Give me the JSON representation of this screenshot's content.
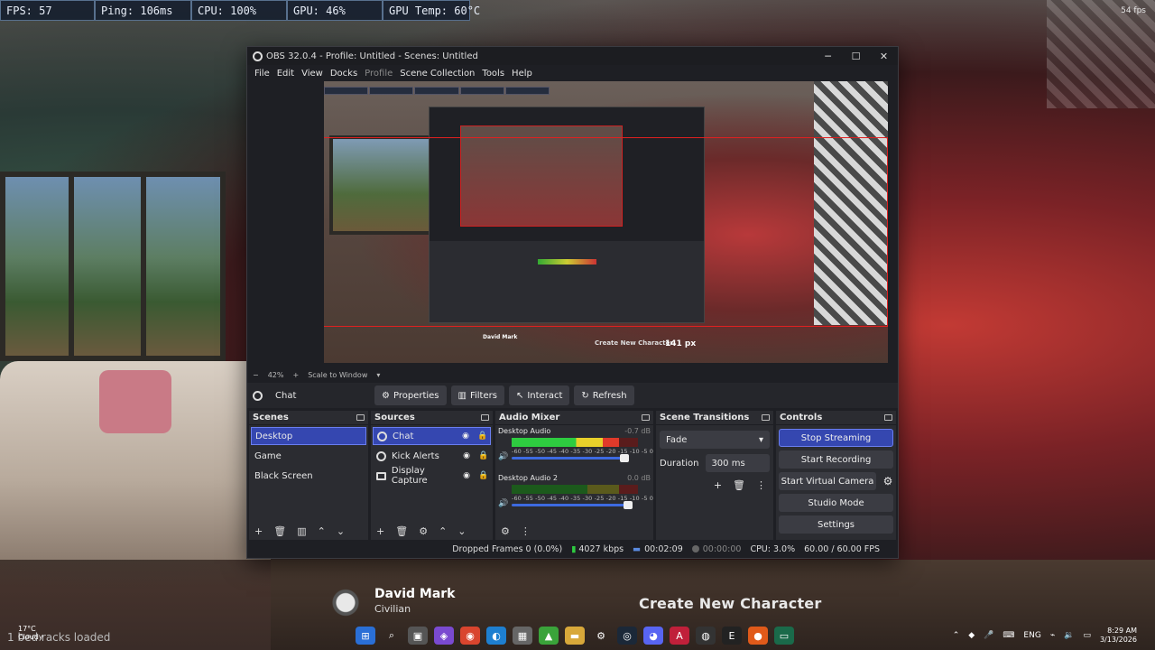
{
  "overlay": {
    "stats": [
      "FPS: 57",
      "Ping: 106ms",
      "CPU: 100%",
      "GPU: 46%",
      "GPU Temp: 60°C"
    ],
    "corner_fps": "54 fps"
  },
  "obs": {
    "title": "OBS 32.0.4 - Profile: Untitled - Scenes: Untitled",
    "menu": [
      "File",
      "Edit",
      "View",
      "Docks",
      "Profile",
      "Scene Collection",
      "Tools",
      "Help"
    ],
    "preview": {
      "measure_label": "141 px",
      "mini_name": "David Mark",
      "mini_cta": "Create New Character"
    },
    "zoom": {
      "minus": "−",
      "level": "42%",
      "plus": "+",
      "mode": "Scale to Window"
    },
    "context": {
      "source_name": "Chat",
      "buttons": {
        "properties": "Properties",
        "filters": "Filters",
        "interact": "Interact",
        "refresh": "Refresh"
      }
    },
    "scenes": {
      "title": "Scenes",
      "items": [
        "Desktop",
        "Game",
        "Black Screen"
      ]
    },
    "sources": {
      "title": "Sources",
      "items": [
        "Chat",
        "Kick Alerts",
        "Display Capture"
      ]
    },
    "mixer": {
      "title": "Audio Mixer",
      "ticks": "-60 -55 -50 -45 -40 -35 -30 -25 -20 -15 -10 -5 0",
      "channels": [
        {
          "name": "Desktop Audio",
          "db": "-0.7 dB",
          "level": 0.85,
          "fader": 0.9
        },
        {
          "name": "Desktop Audio 2",
          "db": "0.0 dB",
          "level": 0.0,
          "fader": 0.93
        }
      ]
    },
    "transitions": {
      "title": "Scene Transitions",
      "selected": "Fade",
      "duration_label": "Duration",
      "duration_value": "300 ms"
    },
    "controls": {
      "title": "Controls",
      "stop_streaming": "Stop Streaming",
      "start_recording": "Start Recording",
      "start_virtual_camera": "Start Virtual Camera",
      "studio_mode": "Studio Mode",
      "settings": "Settings"
    },
    "status": {
      "dropped_frames": "Dropped Frames 0 (0.0%)",
      "bitrate": "4027 kbps",
      "stream_time": "00:02:09",
      "record_time": "00:00:00",
      "cpu": "CPU: 3.0%",
      "fps": "60.00 / 60.00 FPS"
    }
  },
  "game": {
    "name": "David Mark",
    "role": "Civilian",
    "cta": "Create New Character",
    "status": "1 bed racks loaded"
  },
  "taskbar": {
    "weather": "17°C",
    "weather_desc": "Cloudy",
    "lang": "ENG",
    "time": "8:29 AM",
    "date": "3/13/2026"
  }
}
